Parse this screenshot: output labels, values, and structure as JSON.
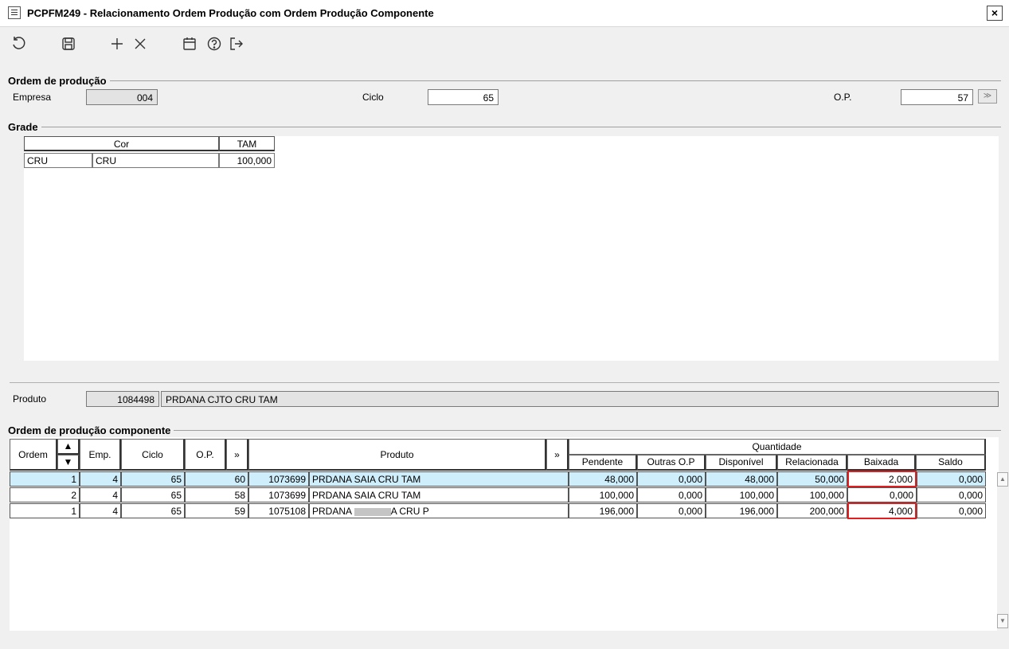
{
  "window": {
    "title": "PCPFM249 - Relacionamento Ordem Produção com Ordem Produção Componente",
    "close_label": "×"
  },
  "toolbar": {
    "icons": [
      "undo-icon",
      "save-icon",
      "add-icon",
      "delete-icon",
      "calendar-icon",
      "help-icon",
      "exit-icon"
    ]
  },
  "ordem_producao": {
    "legend": "Ordem de produção",
    "empresa_label": "Empresa",
    "empresa_value": "004",
    "ciclo_label": "Ciclo",
    "ciclo_value": "65",
    "op_label": "O.P.",
    "op_value": "57"
  },
  "grade": {
    "legend": "Grade",
    "headers": [
      "Cor",
      "TAM"
    ],
    "row": {
      "cor_code": "CRU",
      "cor_name": "CRU",
      "tam": "100,000"
    },
    "produto_label": "Produto",
    "produto_code": "1084498",
    "produto_desc": "PRDANA CJTO CRU TAM"
  },
  "componente": {
    "legend": "Ordem de produção componente",
    "headers": {
      "ordem": "Ordem",
      "emp": "Emp.",
      "ciclo": "Ciclo",
      "op": "O.P.",
      "expand": "»",
      "produto": "Produto",
      "expand2": "»",
      "quantidade": "Quantidade",
      "pendente": "Pendente",
      "outras_op": "Outras O.P",
      "disponivel": "Disponível",
      "relacionada": "Relacionada",
      "baixada": "Baixada",
      "saldo": "Saldo"
    },
    "rows": [
      {
        "ordem": "1",
        "emp": "4",
        "ciclo": "65",
        "op": "60",
        "prod_code": "1073699",
        "prod_desc": "PRDANA SAIA CRU TAM",
        "pendente": "48,000",
        "outras": "0,000",
        "disponivel": "48,000",
        "relacionada": "50,000",
        "baixada": "2,000",
        "saldo": "0,000"
      },
      {
        "ordem": "2",
        "emp": "4",
        "ciclo": "65",
        "op": "58",
        "prod_code": "1073699",
        "prod_desc": "PRDANA SAIA CRU TAM",
        "pendente": "100,000",
        "outras": "0,000",
        "disponivel": "100,000",
        "relacionada": "100,000",
        "baixada": "0,000",
        "saldo": "0,000"
      },
      {
        "ordem": "1",
        "emp": "4",
        "ciclo": "65",
        "op": "59",
        "prod_code": "1075108",
        "prod_desc_a": "PRDANA",
        "prod_desc_b": "A CRU P",
        "pendente": "196,000",
        "outras": "0,000",
        "disponivel": "196,000",
        "relacionada": "200,000",
        "baixada": "4,000",
        "saldo": "0,000"
      }
    ]
  },
  "colors": {
    "selected_row": "#cfeefc",
    "highlight_border": "#e02020"
  }
}
